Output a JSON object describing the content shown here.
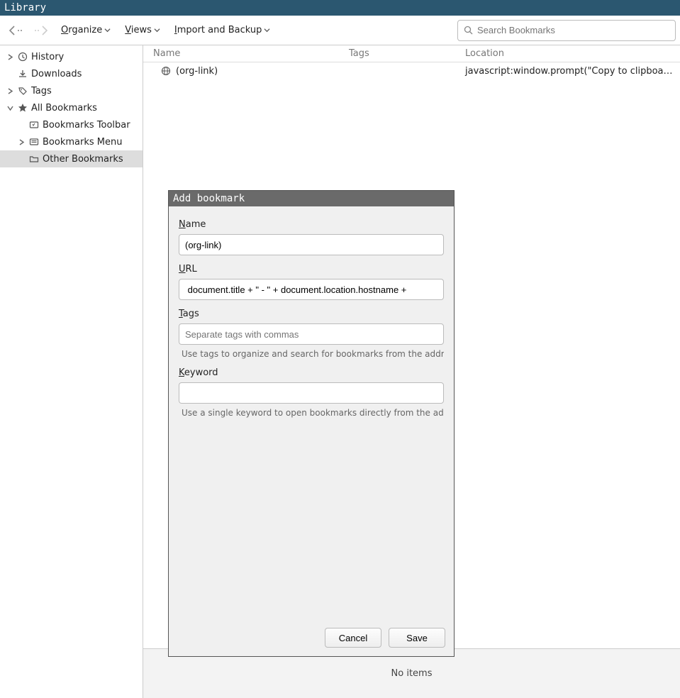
{
  "window": {
    "title": "Library"
  },
  "toolbar": {
    "organize": "Organize",
    "views": "Views",
    "import_backup": "Import and Backup",
    "search_placeholder": "Search Bookmarks"
  },
  "sidebar": {
    "history": "History",
    "downloads": "Downloads",
    "tags": "Tags",
    "all_bookmarks": "All Bookmarks",
    "bookmarks_toolbar": "Bookmarks Toolbar",
    "bookmarks_menu": "Bookmarks Menu",
    "other_bookmarks": "Other Bookmarks"
  },
  "columns": {
    "name": "Name",
    "tags": "Tags",
    "location": "Location"
  },
  "rows": [
    {
      "name": "(org-link)",
      "tags": "",
      "location": "javascript:window.prompt(\"Copy to clipboa…"
    }
  ],
  "footer": {
    "status": "No items"
  },
  "dialog": {
    "title": "Add bookmark",
    "name_label": "Name",
    "name_value": "(org-link)",
    "url_label": "URL",
    "url_value": " document.title + \" - \" + document.location.hostname + ",
    "tags_label": "Tags",
    "tags_placeholder": "Separate tags with commas",
    "tags_hint": "Use tags to organize and search for bookmarks from the address bar",
    "keyword_label": "Keyword",
    "keyword_value": "",
    "keyword_hint": "Use a single keyword to open bookmarks directly from the address bar",
    "cancel": "Cancel",
    "save": "Save"
  }
}
